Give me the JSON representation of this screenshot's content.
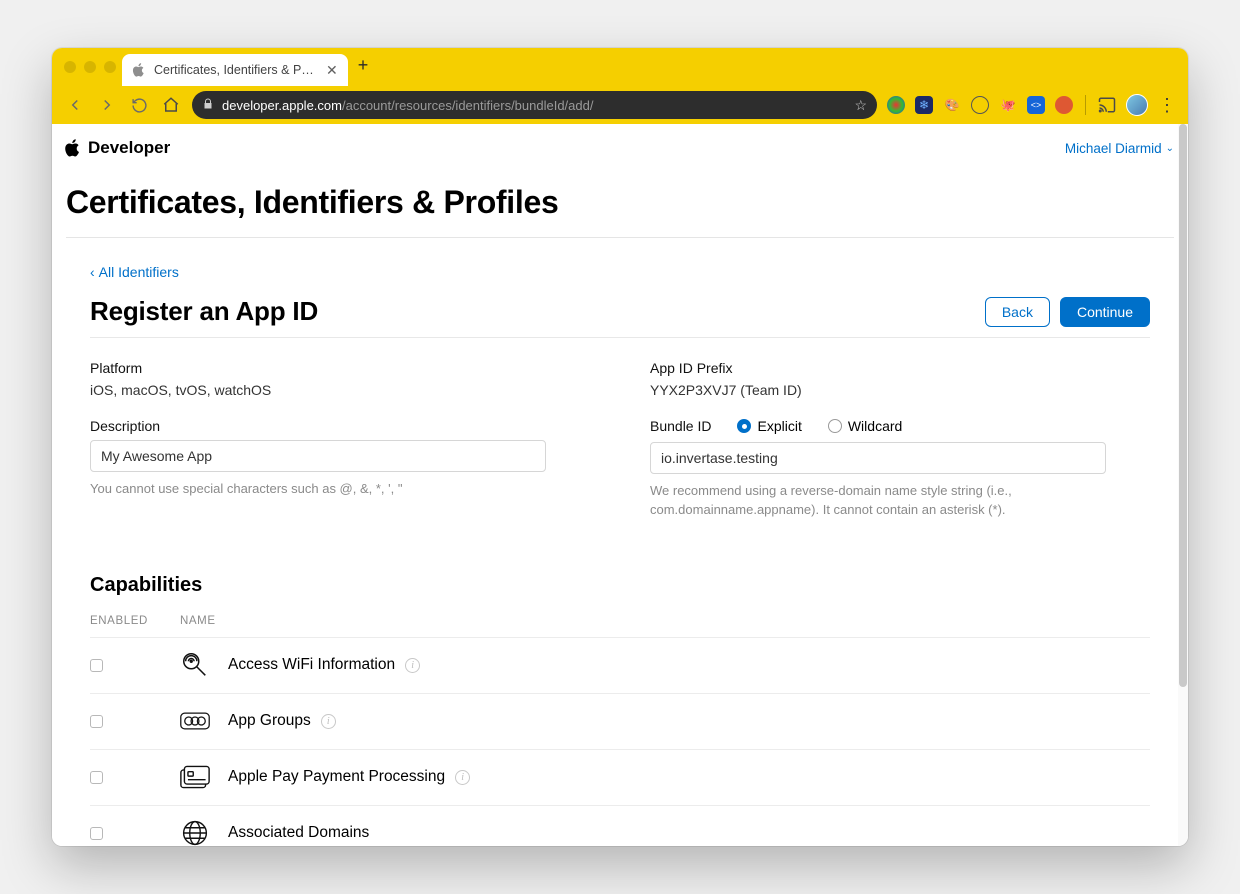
{
  "browser": {
    "tab_title": "Certificates, Identifiers & Profiles",
    "url_domain": "developer.apple.com",
    "url_path": "/account/resources/identifiers/bundleId/add/"
  },
  "header": {
    "brand": "Developer",
    "user_name": "Michael Diarmid"
  },
  "page": {
    "title": "Certificates, Identifiers & Profiles",
    "breadcrumb_label": "All Identifiers",
    "section_title": "Register an App ID",
    "back_label": "Back",
    "continue_label": "Continue"
  },
  "form": {
    "platform_label": "Platform",
    "platform_value": "iOS, macOS, tvOS, watchOS",
    "prefix_label": "App ID Prefix",
    "prefix_value": "YYX2P3XVJ7 (Team ID)",
    "description_label": "Description",
    "description_value": "My Awesome App",
    "description_helper": "You cannot use special characters such as @, &, *, ', \"",
    "bundle_label": "Bundle ID",
    "bundle_explicit_label": "Explicit",
    "bundle_wildcard_label": "Wildcard",
    "bundle_value": "io.invertase.testing",
    "bundle_helper": "We recommend using a reverse-domain name style string (i.e., com.domainname.appname). It cannot contain an asterisk (*)."
  },
  "capabilities": {
    "title": "Capabilities",
    "col_enabled": "ENABLED",
    "col_name": "NAME",
    "rows": [
      {
        "name": "Access WiFi Information"
      },
      {
        "name": "App Groups"
      },
      {
        "name": "Apple Pay Payment Processing"
      },
      {
        "name": "Associated Domains"
      }
    ]
  }
}
